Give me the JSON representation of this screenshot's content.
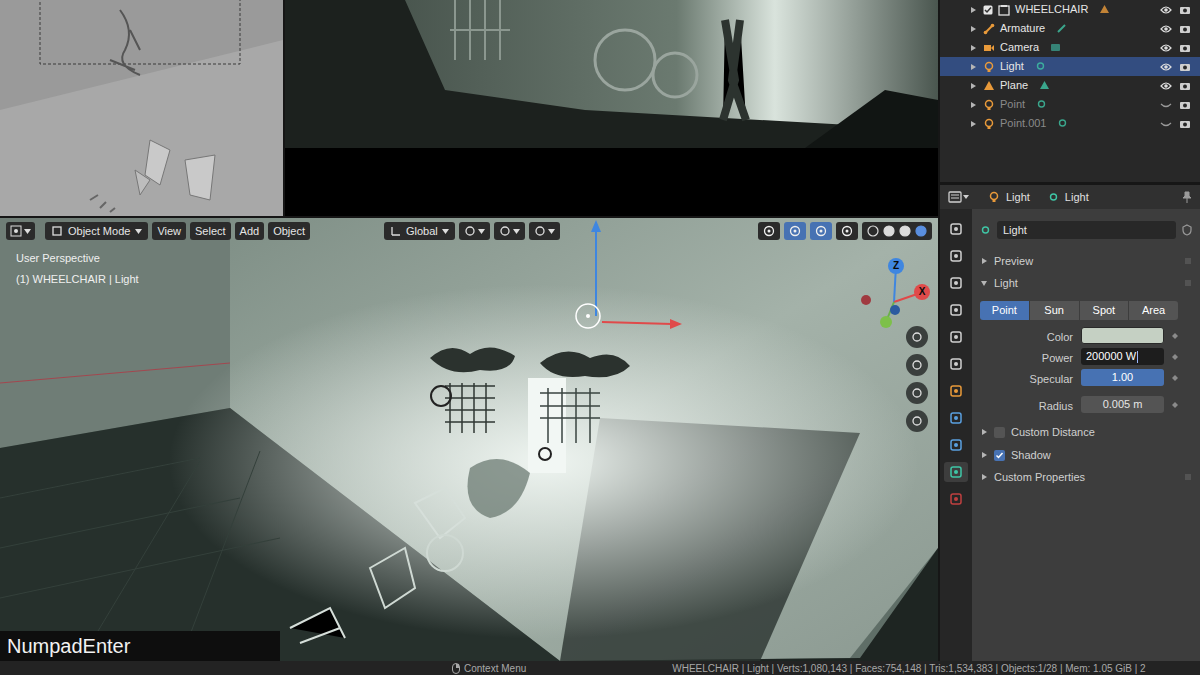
{
  "outliner": {
    "items": [
      {
        "label": "WHEELCHAIR",
        "kind": "collection",
        "selected": false,
        "hidden": false
      },
      {
        "label": "Armature",
        "kind": "armature",
        "selected": false,
        "hidden": false
      },
      {
        "label": "Camera",
        "kind": "camera",
        "selected": false,
        "hidden": false
      },
      {
        "label": "Light",
        "kind": "light",
        "selected": true,
        "hidden": false
      },
      {
        "label": "Plane",
        "kind": "mesh",
        "selected": false,
        "hidden": false
      },
      {
        "label": "Point",
        "kind": "light",
        "selected": false,
        "hidden": true
      },
      {
        "label": "Point.001",
        "kind": "light",
        "selected": false,
        "hidden": true
      }
    ]
  },
  "viewport": {
    "mode": "Object Mode",
    "menus": [
      "View",
      "Select",
      "Add",
      "Object"
    ],
    "orientation": "Global",
    "perspective": "User Perspective",
    "context": "(1) WHEELCHAIR | Light",
    "gizmo_labels": [
      "Z",
      "X"
    ],
    "keystroke": "NumpadEnter"
  },
  "properties": {
    "header": {
      "object": "Light",
      "data": "Light"
    },
    "datablock": "Light",
    "sections": [
      {
        "label": "Preview",
        "expanded": false
      },
      {
        "label": "Light",
        "expanded": true
      }
    ],
    "light_types": [
      {
        "label": "Point",
        "selected": true
      },
      {
        "label": "Sun",
        "selected": false
      },
      {
        "label": "Spot",
        "selected": false
      },
      {
        "label": "Area",
        "selected": false
      }
    ],
    "fields": [
      {
        "label": "Color",
        "kind": "swatch",
        "color": "#c5d0c3"
      },
      {
        "label": "Power",
        "kind": "edit",
        "value": "200000 W"
      },
      {
        "label": "Specular",
        "kind": "slider",
        "value": "1.00",
        "level": 1
      },
      {
        "label": "Radius",
        "kind": "number",
        "value": "0.005 m"
      }
    ],
    "subpanels": [
      {
        "label": "Custom Distance",
        "checked": false
      },
      {
        "label": "Shadow",
        "checked": true
      }
    ],
    "custom_properties": {
      "label": "Custom Properties",
      "expanded": false
    }
  },
  "status_bar": {
    "hint": "Context Menu",
    "stats": "WHEELCHAIR | Light | Verts:1,080,143 | Faces:754,148 | Tris:1,534,383 | Objects:1/28 | Mem: 1.05 GiB | 2"
  }
}
